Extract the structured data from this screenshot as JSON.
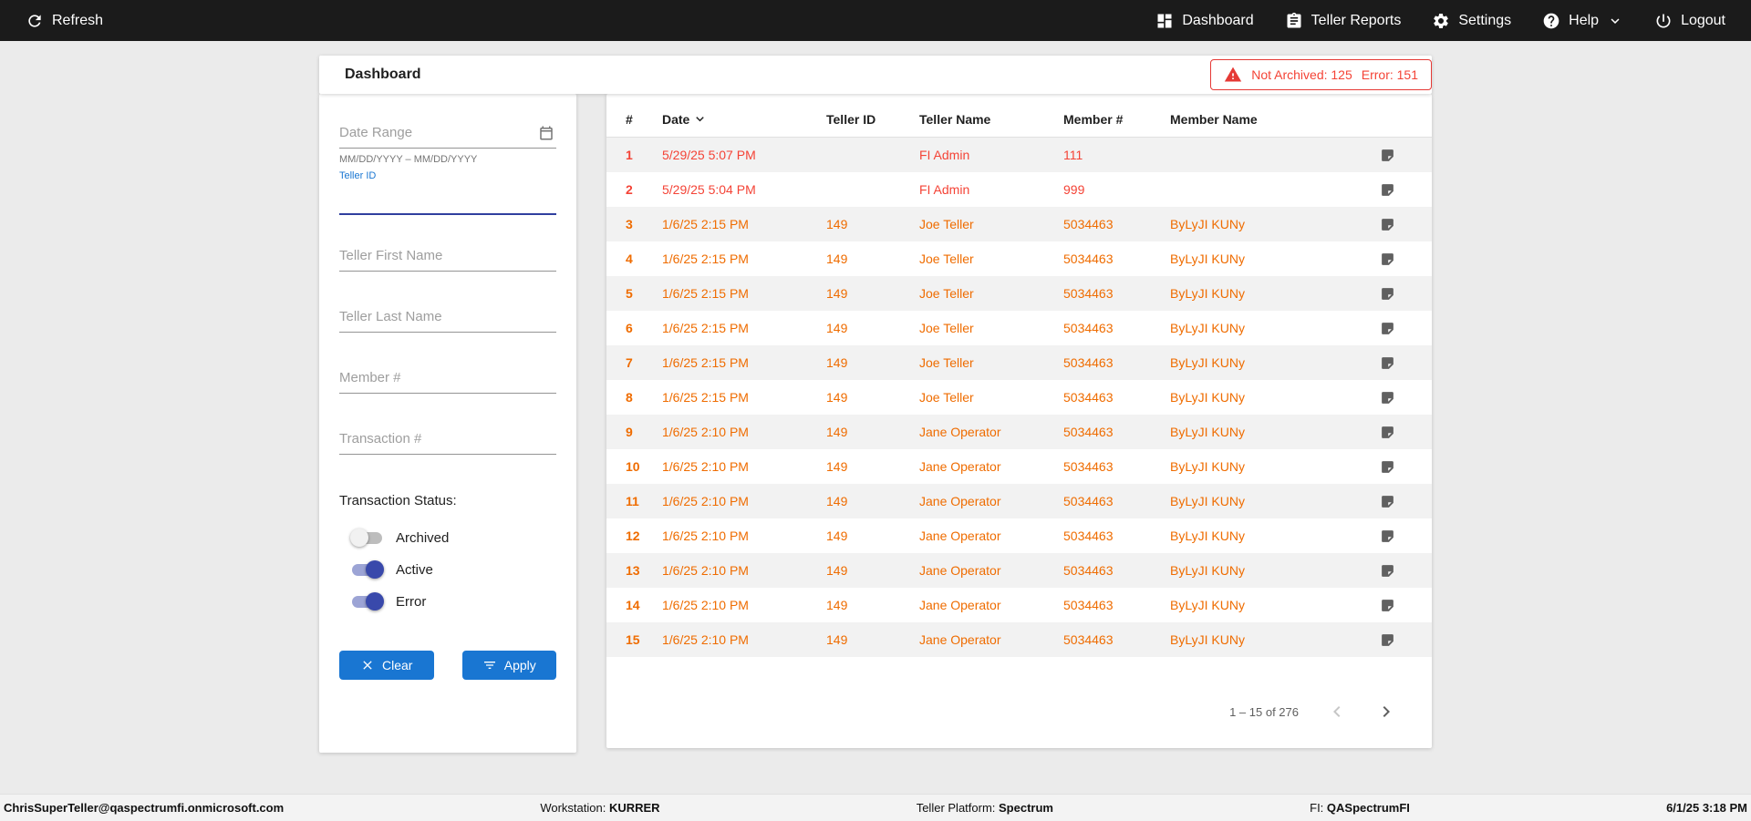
{
  "topbar": {
    "refresh_label": "Refresh",
    "dashboard_label": "Dashboard",
    "teller_reports_label": "Teller Reports",
    "settings_label": "Settings",
    "help_label": "Help",
    "logout_label": "Logout"
  },
  "page": {
    "title": "Dashboard",
    "alert": {
      "not_archived": "Not Archived: 125",
      "error": "Error: 151"
    }
  },
  "filters": {
    "date_range_placeholder": "Date Range",
    "date_hint": "MM/DD/YYYY – MM/DD/YYYY",
    "teller_id_label": "Teller ID",
    "teller_first_name_placeholder": "Teller First Name",
    "teller_last_name_placeholder": "Teller Last Name",
    "member_placeholder": "Member #",
    "transaction_placeholder": "Transaction #",
    "status_label": "Transaction Status:",
    "toggles": [
      {
        "label": "Archived",
        "on": false
      },
      {
        "label": "Active",
        "on": true
      },
      {
        "label": "Error",
        "on": true
      }
    ],
    "clear_label": "Clear",
    "apply_label": "Apply"
  },
  "table": {
    "columns": [
      "#",
      "Date",
      "Teller ID",
      "Teller Name",
      "Member #",
      "Member Name"
    ],
    "rows": [
      {
        "num": "1",
        "date": "5/29/25 5:07 PM",
        "teller_id": "",
        "teller_name": "FI Admin",
        "member_num": "111",
        "member_name": "",
        "status": "error"
      },
      {
        "num": "2",
        "date": "5/29/25 5:04 PM",
        "teller_id": "",
        "teller_name": "FI Admin",
        "member_num": "999",
        "member_name": "",
        "status": "error"
      },
      {
        "num": "3",
        "date": "1/6/25 2:15 PM",
        "teller_id": "149",
        "teller_name": "Joe Teller",
        "member_num": "5034463",
        "member_name": "ByLyJI KUNy",
        "status": "active"
      },
      {
        "num": "4",
        "date": "1/6/25 2:15 PM",
        "teller_id": "149",
        "teller_name": "Joe Teller",
        "member_num": "5034463",
        "member_name": "ByLyJI KUNy",
        "status": "active"
      },
      {
        "num": "5",
        "date": "1/6/25 2:15 PM",
        "teller_id": "149",
        "teller_name": "Joe Teller",
        "member_num": "5034463",
        "member_name": "ByLyJI KUNy",
        "status": "active"
      },
      {
        "num": "6",
        "date": "1/6/25 2:15 PM",
        "teller_id": "149",
        "teller_name": "Joe Teller",
        "member_num": "5034463",
        "member_name": "ByLyJI KUNy",
        "status": "active"
      },
      {
        "num": "7",
        "date": "1/6/25 2:15 PM",
        "teller_id": "149",
        "teller_name": "Joe Teller",
        "member_num": "5034463",
        "member_name": "ByLyJI KUNy",
        "status": "active"
      },
      {
        "num": "8",
        "date": "1/6/25 2:15 PM",
        "teller_id": "149",
        "teller_name": "Joe Teller",
        "member_num": "5034463",
        "member_name": "ByLyJI KUNy",
        "status": "active"
      },
      {
        "num": "9",
        "date": "1/6/25 2:10 PM",
        "teller_id": "149",
        "teller_name": "Jane Operator",
        "member_num": "5034463",
        "member_name": "ByLyJI KUNy",
        "status": "active"
      },
      {
        "num": "10",
        "date": "1/6/25 2:10 PM",
        "teller_id": "149",
        "teller_name": "Jane Operator",
        "member_num": "5034463",
        "member_name": "ByLyJI KUNy",
        "status": "active"
      },
      {
        "num": "11",
        "date": "1/6/25 2:10 PM",
        "teller_id": "149",
        "teller_name": "Jane Operator",
        "member_num": "5034463",
        "member_name": "ByLyJI KUNy",
        "status": "active"
      },
      {
        "num": "12",
        "date": "1/6/25 2:10 PM",
        "teller_id": "149",
        "teller_name": "Jane Operator",
        "member_num": "5034463",
        "member_name": "ByLyJI KUNy",
        "status": "active"
      },
      {
        "num": "13",
        "date": "1/6/25 2:10 PM",
        "teller_id": "149",
        "teller_name": "Jane Operator",
        "member_num": "5034463",
        "member_name": "ByLyJI KUNy",
        "status": "active"
      },
      {
        "num": "14",
        "date": "1/6/25 2:10 PM",
        "teller_id": "149",
        "teller_name": "Jane Operator",
        "member_num": "5034463",
        "member_name": "ByLyJI KUNy",
        "status": "active"
      },
      {
        "num": "15",
        "date": "1/6/25 2:10 PM",
        "teller_id": "149",
        "teller_name": "Jane Operator",
        "member_num": "5034463",
        "member_name": "ByLyJI KUNy",
        "status": "active"
      }
    ],
    "pagination_label": "1 – 15 of 276"
  },
  "statusbar": {
    "user": "ChrisSuperTeller@qaspectrumfi.onmicrosoft.com",
    "workstation_label": "Workstation: ",
    "workstation_value": "KURRER",
    "platform_label": "Teller Platform: ",
    "platform_value": "Spectrum",
    "fi_label": "FI: ",
    "fi_value": "QASpectrumFI",
    "datetime": "6/1/25 3:18 PM"
  },
  "colors": {
    "error_text": "#f44336",
    "active_text": "#ef6c00",
    "accent_blue": "#1976d2",
    "toggle_on": "#3949ab",
    "topbar_bg": "#1b1b1b"
  }
}
